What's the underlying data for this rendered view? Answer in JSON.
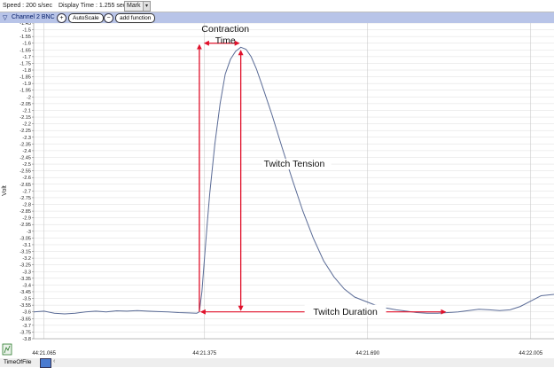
{
  "topbar": {
    "speed": "Speed : 200 s/sec",
    "display_time": "Display Time : 1.255 sec",
    "mark_label": "Mark",
    "mark_dropdown": "▾"
  },
  "channel_bar": {
    "channel_name": "Channel 2 BNC",
    "autoscale_label": "AutoScale",
    "add_function_label": "add function"
  },
  "chart_data": {
    "type": "line",
    "ylabel": "Volt",
    "ylim": [
      -3.8,
      -1.45
    ],
    "y_tick_step": 0.05,
    "y_ticks": [
      "-1.45",
      "-1.5",
      "-1.55",
      "-1.6",
      "-1.65",
      "-1.7",
      "-1.75",
      "-1.8",
      "-1.85",
      "-1.9",
      "-1.95",
      "-2",
      "-2.05",
      "-2.1",
      "-2.15",
      "-2.2",
      "-2.25",
      "-2.3",
      "-2.35",
      "-2.4",
      "-2.45",
      "-2.5",
      "-2.55",
      "-2.6",
      "-2.65",
      "-2.7",
      "-2.75",
      "-2.8",
      "-2.85",
      "-2.9",
      "-2.95",
      "-3",
      "-3.05",
      "-3.1",
      "-3.15",
      "-3.2",
      "-3.25",
      "-3.3",
      "-3.35",
      "-3.4",
      "-3.45",
      "-3.5",
      "-3.55",
      "-3.6",
      "-3.65",
      "-3.7",
      "-3.75",
      "-3.8"
    ],
    "x_ticks": [
      {
        "label": "44:21.065",
        "t": 0
      },
      {
        "label": "44:21.375",
        "t": 0.31
      },
      {
        "label": "44:21.690",
        "t": 0.625
      },
      {
        "label": "44:22.005",
        "t": 0.94
      }
    ],
    "xlim": [
      -0.02,
      0.985
    ],
    "series": [
      {
        "values": [
          [
            -0.02,
            -3.6
          ],
          [
            0.0,
            -3.595
          ],
          [
            0.02,
            -3.61
          ],
          [
            0.04,
            -3.615
          ],
          [
            0.06,
            -3.61
          ],
          [
            0.08,
            -3.6
          ],
          [
            0.1,
            -3.595
          ],
          [
            0.12,
            -3.6
          ],
          [
            0.14,
            -3.592
          ],
          [
            0.16,
            -3.595
          ],
          [
            0.18,
            -3.59
          ],
          [
            0.2,
            -3.595
          ],
          [
            0.22,
            -3.598
          ],
          [
            0.24,
            -3.6
          ],
          [
            0.26,
            -3.605
          ],
          [
            0.28,
            -3.608
          ],
          [
            0.295,
            -3.61
          ],
          [
            0.3,
            -3.6
          ],
          [
            0.305,
            -3.45
          ],
          [
            0.31,
            -3.2
          ],
          [
            0.315,
            -2.95
          ],
          [
            0.32,
            -2.72
          ],
          [
            0.33,
            -2.35
          ],
          [
            0.34,
            -2.05
          ],
          [
            0.35,
            -1.83
          ],
          [
            0.36,
            -1.72
          ],
          [
            0.37,
            -1.66
          ],
          [
            0.38,
            -1.63
          ],
          [
            0.39,
            -1.645
          ],
          [
            0.4,
            -1.7
          ],
          [
            0.41,
            -1.79
          ],
          [
            0.42,
            -1.9
          ],
          [
            0.44,
            -2.13
          ],
          [
            0.46,
            -2.38
          ],
          [
            0.48,
            -2.62
          ],
          [
            0.5,
            -2.85
          ],
          [
            0.52,
            -3.05
          ],
          [
            0.54,
            -3.22
          ],
          [
            0.56,
            -3.34
          ],
          [
            0.58,
            -3.43
          ],
          [
            0.6,
            -3.49
          ],
          [
            0.62,
            -3.52
          ],
          [
            0.64,
            -3.55
          ],
          [
            0.66,
            -3.57
          ],
          [
            0.68,
            -3.585
          ],
          [
            0.7,
            -3.595
          ],
          [
            0.72,
            -3.605
          ],
          [
            0.74,
            -3.61
          ],
          [
            0.76,
            -3.61
          ],
          [
            0.78,
            -3.605
          ],
          [
            0.8,
            -3.6
          ],
          [
            0.82,
            -3.59
          ],
          [
            0.84,
            -3.58
          ],
          [
            0.86,
            -3.585
          ],
          [
            0.88,
            -3.59
          ],
          [
            0.9,
            -3.585
          ],
          [
            0.92,
            -3.56
          ],
          [
            0.94,
            -3.52
          ],
          [
            0.96,
            -3.48
          ],
          [
            0.985,
            -3.47
          ]
        ]
      }
    ],
    "annotations": {
      "contraction_time": [
        "Contraction",
        "Time"
      ],
      "twitch_tension": "Twitch Tension",
      "twitch_duration": "Twitch Duration"
    },
    "colors": {
      "trace": "#5a6b96",
      "annotation": "#e0102a",
      "grid": "#dddddd",
      "vgrid": "#cccccc"
    },
    "grid": true
  },
  "bottombar": {
    "time_of_file": "TimeOfFile"
  }
}
